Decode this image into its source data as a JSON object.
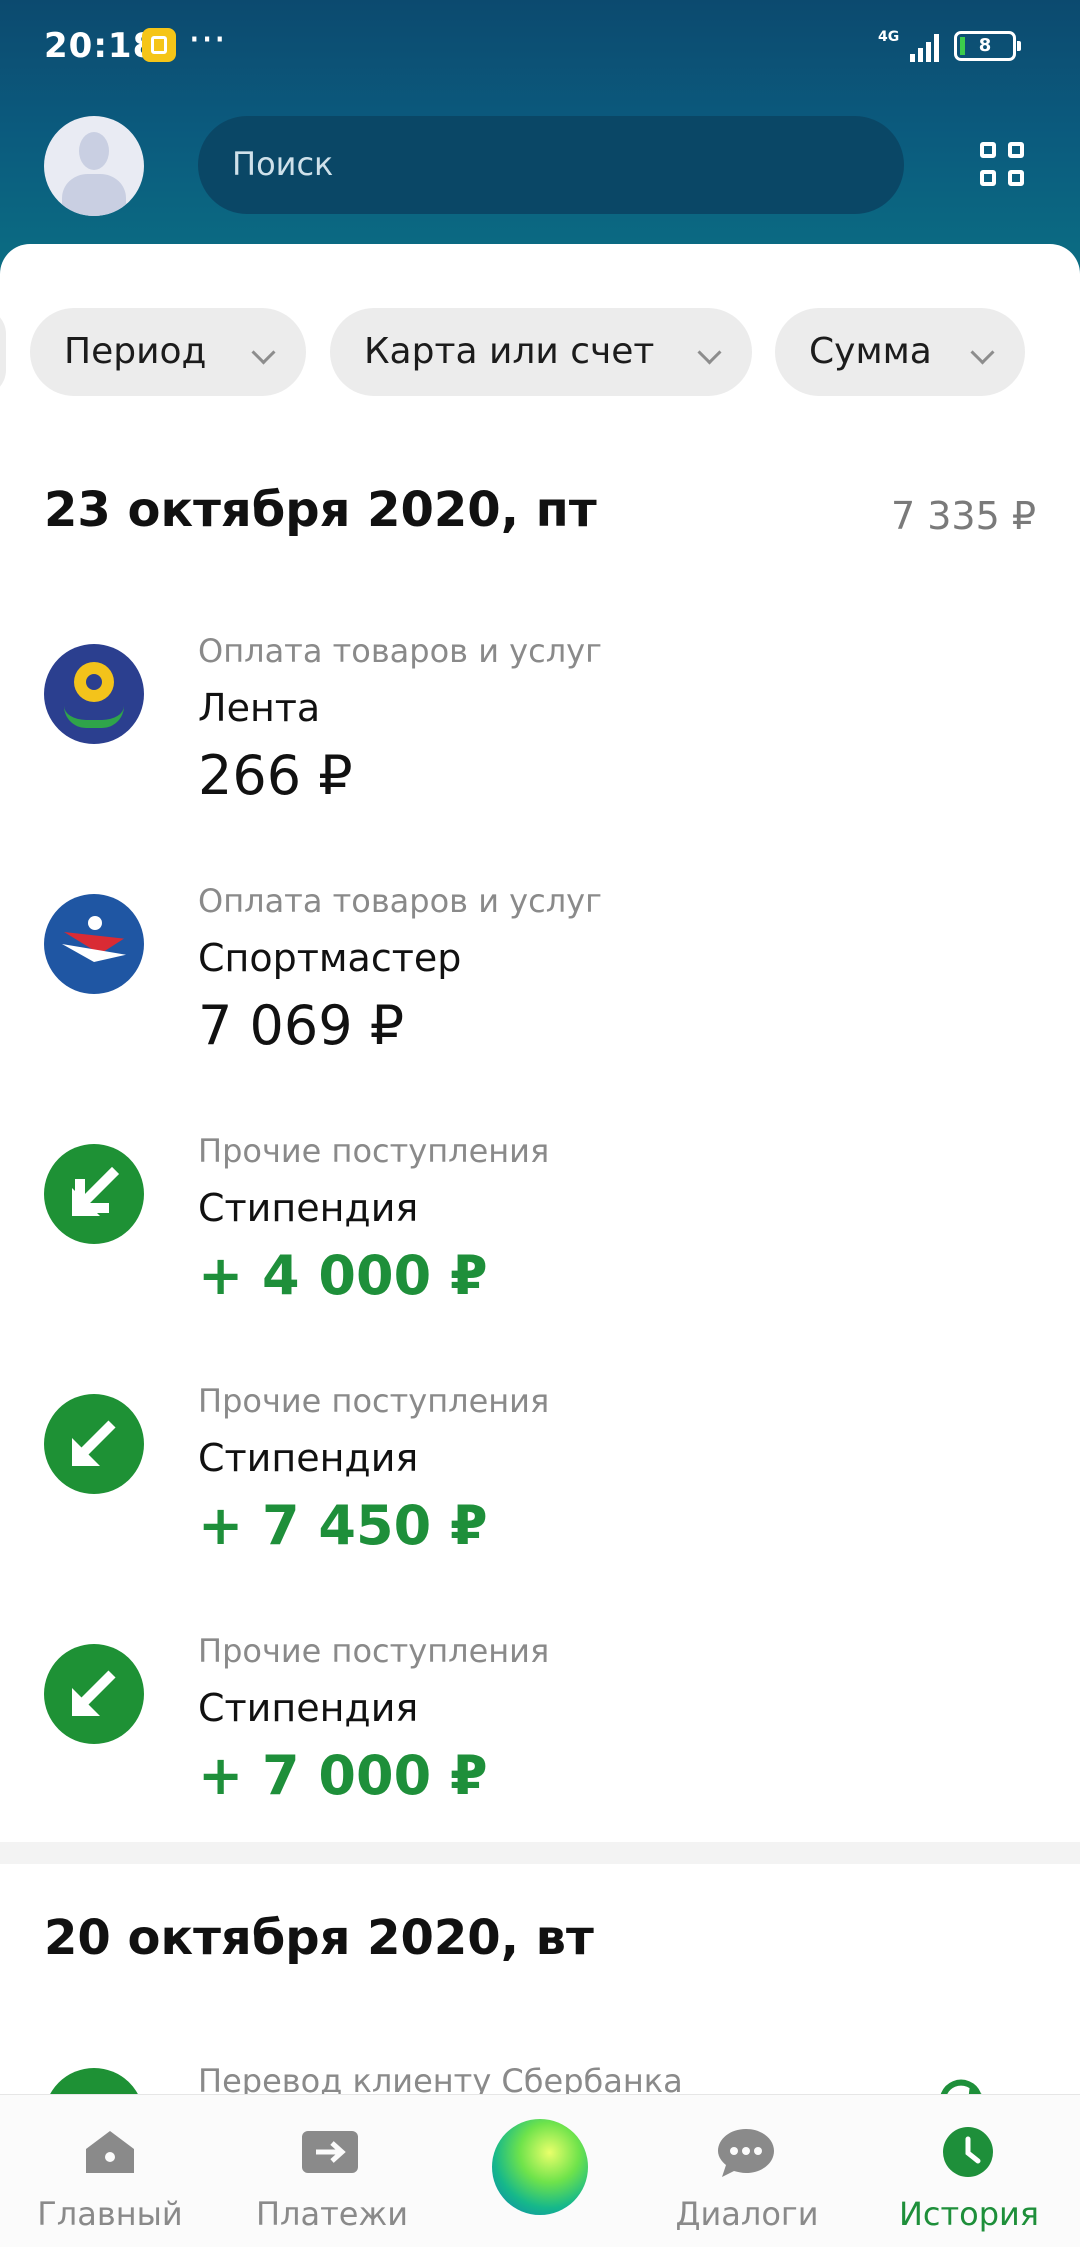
{
  "status_bar": {
    "time": "20:18",
    "network": "4G",
    "battery": "8"
  },
  "header": {
    "search_placeholder": "Поиск"
  },
  "filters": [
    {
      "label": "Период"
    },
    {
      "label": "Карта или счет"
    },
    {
      "label": "Сумма"
    }
  ],
  "groups": [
    {
      "date": "23 октября 2020, пт",
      "total": "7 335 ₽",
      "transactions": [
        {
          "category": "Оплата товаров и услуг",
          "merchant": "Лента",
          "amount": "266 ₽",
          "icon": "lenta-logo-icon"
        },
        {
          "category": "Оплата товаров и услуг",
          "merchant": "Спортмастер",
          "amount": "7 069 ₽",
          "icon": "sportmaster-logo-icon"
        },
        {
          "category": "Прочие поступления",
          "merchant": "Стипендия",
          "amount": "+ 4 000 ₽",
          "icon": "incoming-arrow-icon"
        },
        {
          "category": "Прочие поступления",
          "merchant": "Стипендия",
          "amount": "+ 7 450 ₽",
          "icon": "incoming-arrow-icon"
        },
        {
          "category": "Прочие поступления",
          "merchant": "Стипендия",
          "amount": "+ 7 000 ₽",
          "icon": "incoming-arrow-icon"
        }
      ]
    },
    {
      "date": "20 октября 2020, вт",
      "transactions": [
        {
          "category": "Перевод клиенту Сбербанка",
          "icon": "transfer-icon"
        }
      ]
    }
  ],
  "bottom_nav": [
    {
      "label": "Главный",
      "icon": "home-icon"
    },
    {
      "label": "Платежи",
      "icon": "payments-icon"
    },
    {
      "label": "",
      "icon": "assistant-icon"
    },
    {
      "label": "Диалоги",
      "icon": "chat-icon"
    },
    {
      "label": "История",
      "icon": "clock-icon",
      "active": true
    }
  ],
  "colors": {
    "accent_green": "#1e8f3a",
    "header_blue": "#0c4a6f"
  }
}
